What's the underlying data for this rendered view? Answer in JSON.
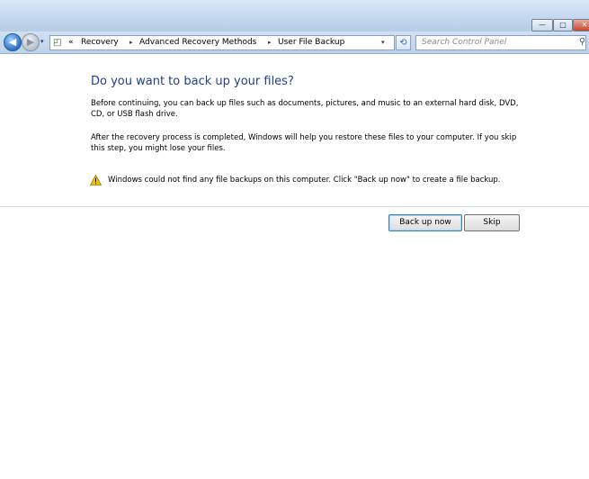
{
  "window": {
    "controls": {
      "minimize": "—",
      "maximize": "□",
      "close": "✕"
    }
  },
  "nav": {
    "back_icon": "arrow-left-icon",
    "forward_icon": "arrow-right-icon",
    "history_dropdown": "▾",
    "address_prefix": "«",
    "breadcrumbs": [
      "Recovery",
      "Advanced Recovery Methods",
      "User File Backup"
    ],
    "breadcrumb_separator": "▸",
    "address_dropdown": "▾",
    "refresh_icon": "refresh-icon",
    "search_placeholder": "Search Control Panel"
  },
  "content": {
    "heading": "Do you want to back up your files?",
    "paragraph1": "Before continuing, you can back up files such as documents, pictures, and music to an external hard disk, DVD, CD, or USB flash drive.",
    "paragraph2": "After the recovery process is completed, Windows will help you restore these files to  your computer.  If you skip this step, you might lose your files.",
    "warning": "Windows could not find any file backups on this computer. Click \"Back up now\" to create a file backup.",
    "buttons": {
      "primary": "Back up now",
      "secondary": "Skip"
    }
  },
  "colors": {
    "heading": "#1e3f8a",
    "warning_icon": "#f2c200",
    "accent": "#3c7fb1"
  }
}
